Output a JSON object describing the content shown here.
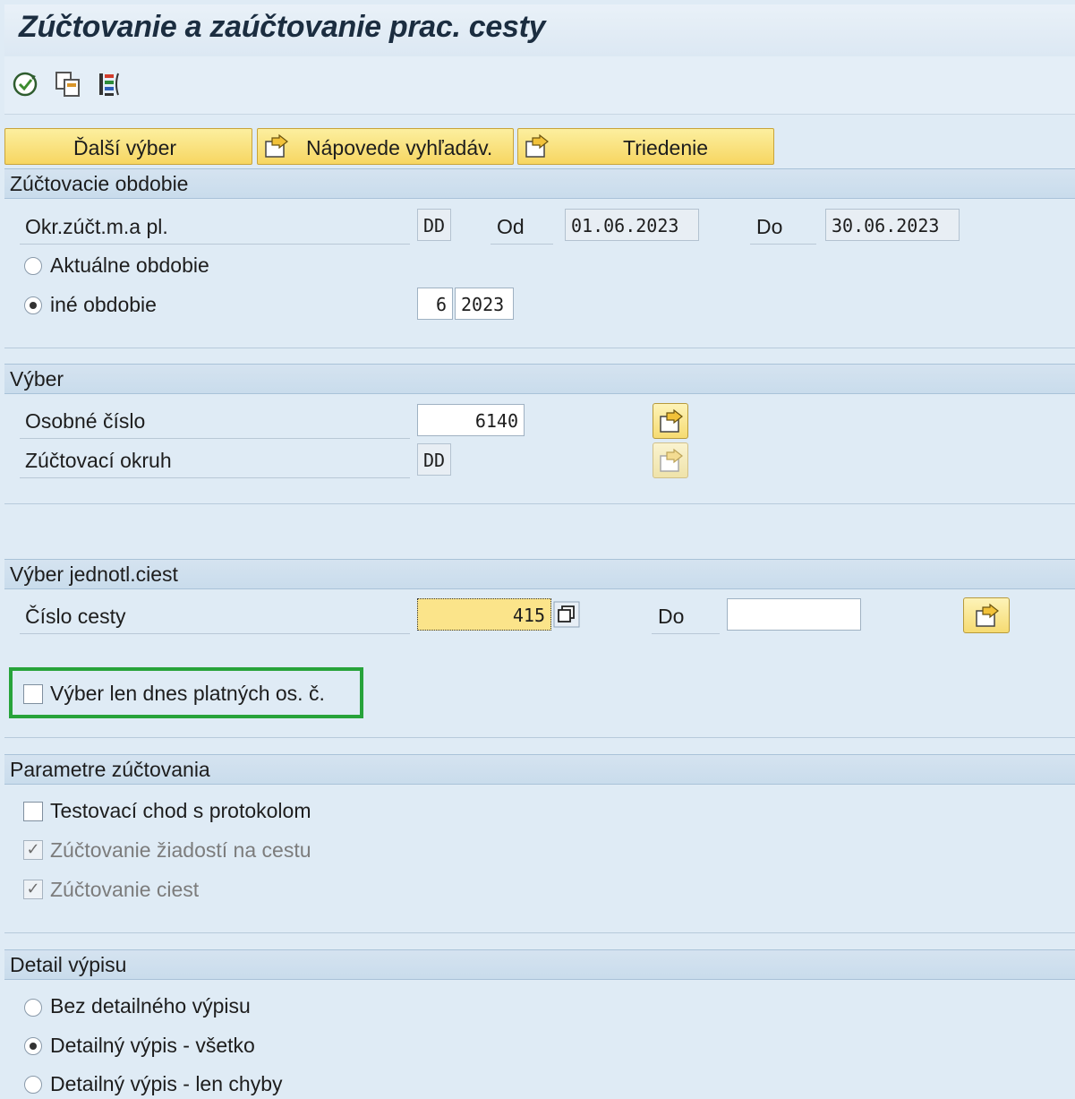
{
  "title": "Zúčtovanie a zaúčtovanie prac. cesty",
  "toolbar": {
    "icons": [
      "execute-icon",
      "copy-variant-icon",
      "list-icon"
    ]
  },
  "buttons": {
    "dalsi_vyber": "Ďalší výber",
    "napovede": "Nápovede vyhľadáv.",
    "triedenie": "Triedenie"
  },
  "sections": {
    "obdobie": {
      "header": "Zúčtovacie obdobie",
      "okr_label": "Okr.zúčt.m.a pl.",
      "okr_value": "DD",
      "od_label": "Od",
      "od_value": "01.06.2023",
      "do_label": "Do",
      "do_value": "30.06.2023",
      "aktualne_label": "Aktuálne obdobie",
      "ine_label": "iné obdobie",
      "ine_month": "6",
      "ine_year": "2023",
      "selected": "ine"
    },
    "vyber": {
      "header": "Výber",
      "osobne_label": "Osobné číslo",
      "osobne_value": "6140",
      "okruh_label": "Zúčtovací okruh",
      "okruh_value": "DD"
    },
    "cesty": {
      "header": "Výber jednotl.ciest",
      "cislo_label": "Číslo cesty",
      "cislo_value": "415",
      "do_label": "Do",
      "do_value": "",
      "platnych_label": "Výber len dnes platných os. č.",
      "platnych_checked": false
    },
    "parametre": {
      "header": "Parametre zúčtovania",
      "testovaci_label": "Testovací chod s protokolom",
      "testovaci_checked": false,
      "ziadosti_label": "Zúčtovanie žiadostí na cestu",
      "ziadosti_checked": true,
      "ciest_label": "Zúčtovanie ciest",
      "ciest_checked": true
    },
    "detail": {
      "header": "Detail výpisu",
      "bez_label": "Bez detailného výpisu",
      "vsetko_label": "Detailný výpis - všetko",
      "chyby_label": "Detailný výpis - len chyby",
      "selected": "vsetko"
    }
  },
  "colors": {
    "background": "#dfebf5",
    "button_yellow": "#f7d662",
    "highlight_green": "#27a33a",
    "focus_field": "#fbe48a"
  }
}
